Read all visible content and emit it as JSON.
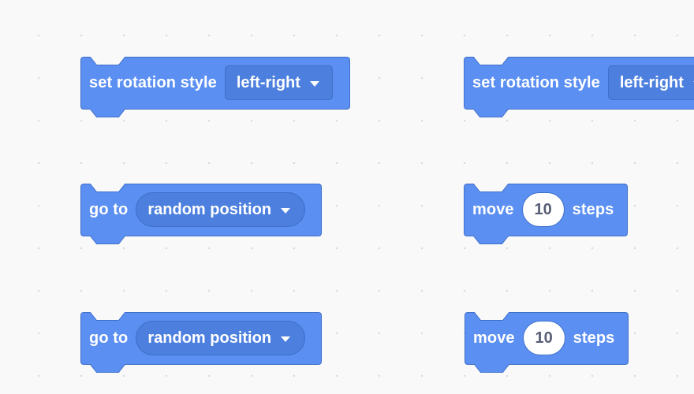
{
  "palette": {
    "motion_fill": "#5b8ff2",
    "motion_stroke": "#3f6fc8",
    "field_fill": "#4c7fde",
    "input_text": "#575e75",
    "workspace_bg": "#f9f9f9"
  },
  "blocks": [
    {
      "opcode": "set rotation style",
      "label": "set rotation style",
      "dropdown": "left-right",
      "dropdown_icon": "caret-down-icon"
    },
    {
      "opcode": "set rotation style",
      "label": "set rotation style",
      "dropdown": "left-right",
      "dropdown_icon": "caret-down-icon"
    },
    {
      "opcode": "go to",
      "label": "go to",
      "dropdown": "random position",
      "dropdown_icon": "caret-down-icon"
    },
    {
      "opcode": "move steps",
      "label_before": "move",
      "value": "10",
      "label_after": "steps"
    },
    {
      "opcode": "go to",
      "label": "go to",
      "dropdown": "random position",
      "dropdown_icon": "caret-down-icon"
    },
    {
      "opcode": "move steps",
      "label_before": "move",
      "value": "10",
      "label_after": "steps"
    }
  ]
}
